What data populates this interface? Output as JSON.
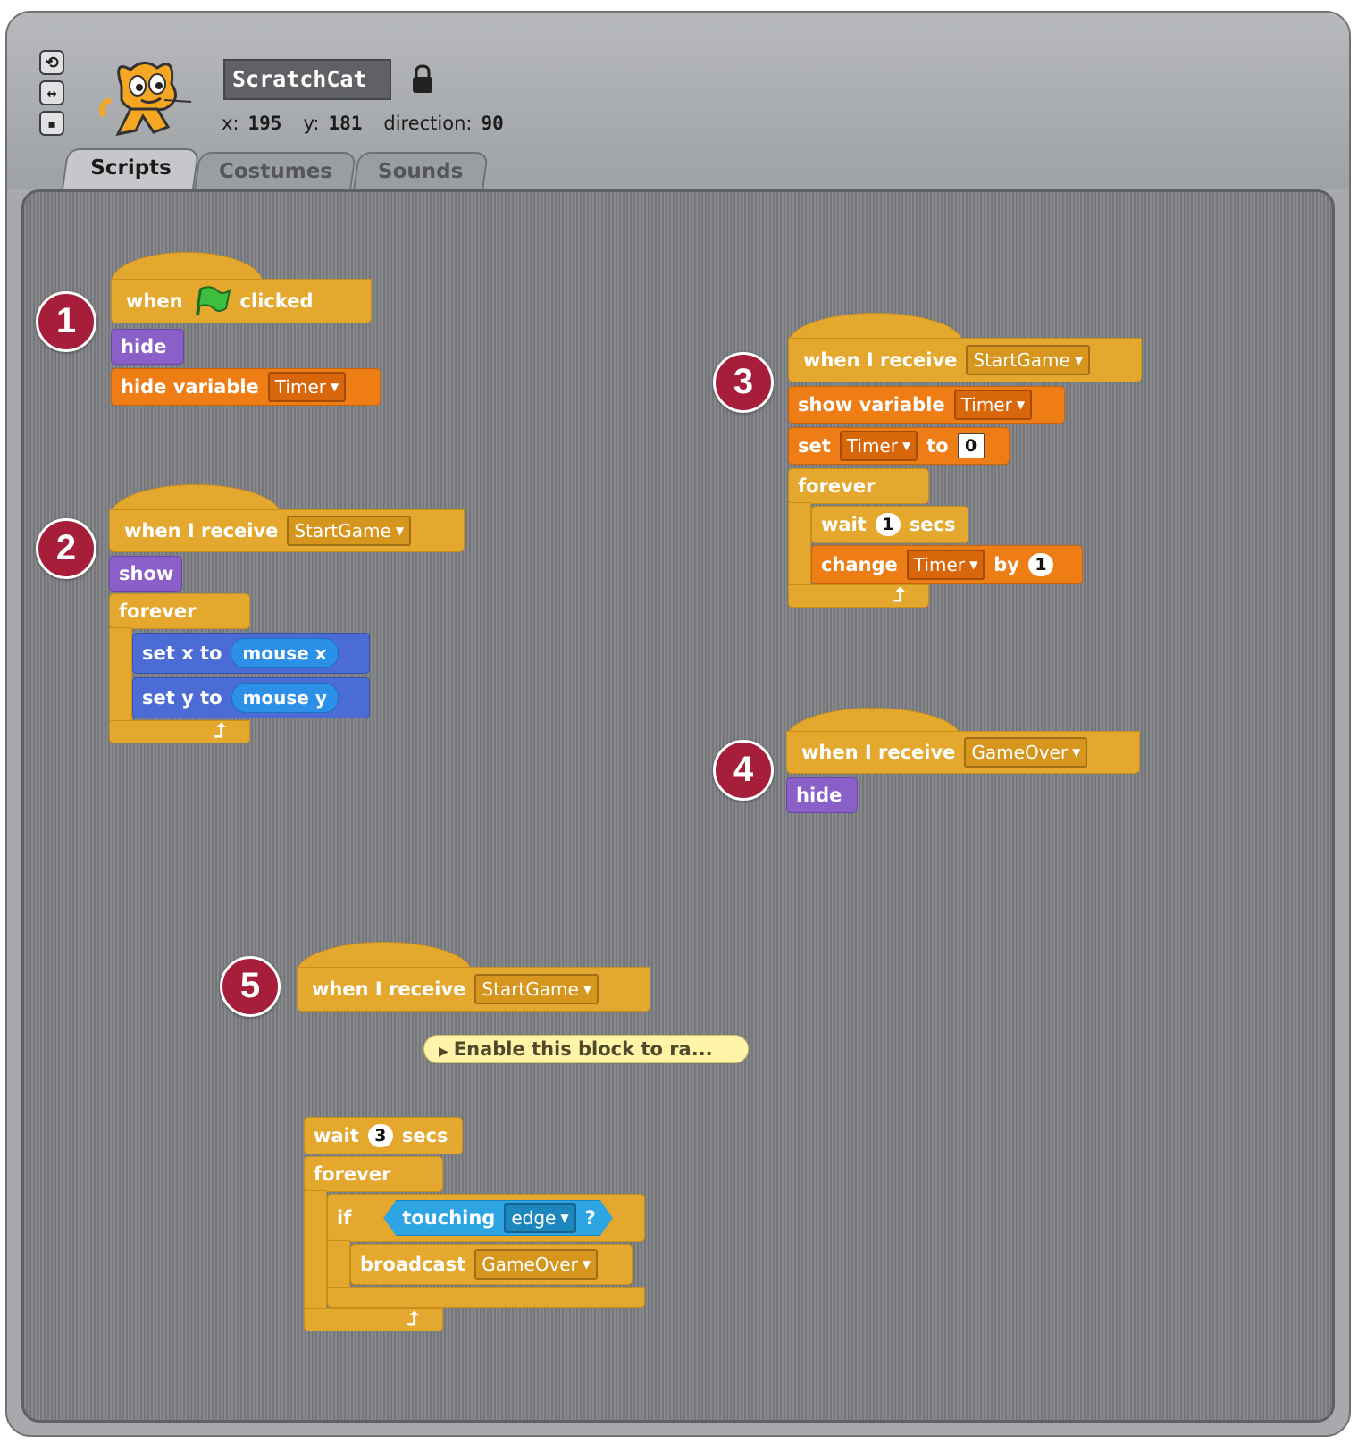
{
  "sprite": {
    "name": "ScratchCat",
    "x_label": "x:",
    "x_value": "195",
    "y_label": "y:",
    "y_value": "181",
    "direction_label": "direction:",
    "direction_value": "90"
  },
  "rotation_buttons": [
    "rotate-icon",
    "flip-horizontal-icon",
    "no-rotate-icon"
  ],
  "tabs": [
    {
      "label": "Scripts",
      "active": true
    },
    {
      "label": "Costumes",
      "active": false
    },
    {
      "label": "Sounds",
      "active": false
    }
  ],
  "badges": [
    "1",
    "2",
    "3",
    "4",
    "5"
  ],
  "scripts": {
    "s1": {
      "hat": {
        "when": "when",
        "clicked": "clicked"
      },
      "hide": "hide",
      "hide_variable": "hide variable",
      "var": "Timer"
    },
    "s2": {
      "hat": {
        "label": "when I receive",
        "message": "StartGame"
      },
      "show": "show",
      "forever": "forever",
      "setx": {
        "label": "set x to",
        "reporter": "mouse x"
      },
      "sety": {
        "label": "set y to",
        "reporter": "mouse y"
      }
    },
    "s3": {
      "hat": {
        "label": "when I receive",
        "message": "StartGame"
      },
      "show_variable": "show variable",
      "var": "Timer",
      "set": {
        "label": "set",
        "var": "Timer",
        "to": "to",
        "value": "0"
      },
      "forever": "forever",
      "wait": {
        "label": "wait",
        "value": "1",
        "unit": "secs"
      },
      "change": {
        "label": "change",
        "var": "Timer",
        "by": "by",
        "value": "1"
      }
    },
    "s4": {
      "hat": {
        "label": "when I receive",
        "message": "GameOver"
      },
      "hide": "hide"
    },
    "s5": {
      "hat": {
        "label": "when I receive",
        "message": "StartGame"
      },
      "comment": "Enable this block to ra...",
      "wait": {
        "label": "wait",
        "value": "3",
        "unit": "secs"
      },
      "forever": "forever",
      "if": "if",
      "touching": {
        "label": "touching",
        "option": "edge",
        "q": "?"
      },
      "broadcast": {
        "label": "broadcast",
        "message": "GameOver"
      }
    }
  },
  "colors": {
    "control": "#e5a82e",
    "looks": "#8a5fc8",
    "variables": "#ee7d16",
    "motion": "#4a6cd4",
    "sensing": "#2ca5e2",
    "badge": "#a61e3a"
  }
}
